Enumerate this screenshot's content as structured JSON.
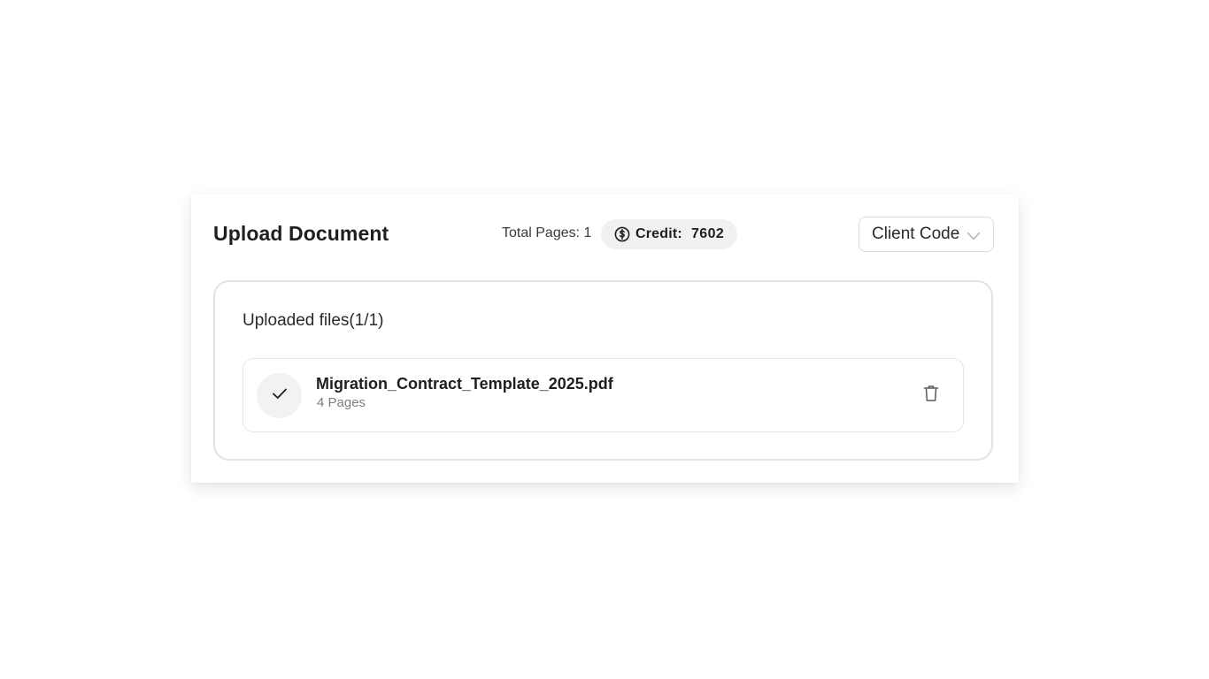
{
  "header": {
    "title": "Upload Document",
    "total_pages": "Total Pages: 1",
    "credit_label": "Credit:",
    "credit_value": "7602",
    "credit_icon": "dollar-circle-icon",
    "client_code_placeholder": "Client Code",
    "client_code_icon": "chevron-down-icon"
  },
  "uploads": {
    "heading": "Uploaded files(1/1)",
    "files": [
      {
        "name": "Migration_Contract_Template_2025.pdf",
        "pages": "4 Pages",
        "status_icon": "check-icon",
        "delete_icon": "trash-icon"
      }
    ]
  },
  "colors": {
    "pill_bg": "#f1f1f3",
    "border": "#e3e3e6",
    "muted_text": "#808080"
  }
}
